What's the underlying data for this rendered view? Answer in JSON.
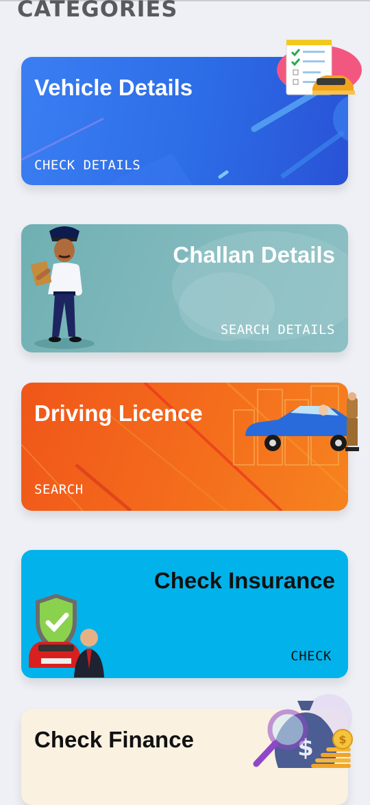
{
  "page": {
    "heading": "CATEGORIES"
  },
  "cards": [
    {
      "title": "Vehicle Details",
      "action": "CHECK DETAILS"
    },
    {
      "title": "Challan Details",
      "action": "SEARCH DETAILS"
    },
    {
      "title": "Driving Licence",
      "action": "SEARCH"
    },
    {
      "title": "Check Insurance",
      "action": "CHECK"
    },
    {
      "title": "Check Finance",
      "action": ""
    }
  ],
  "colors": {
    "vehicle_card": "#2c6ce6",
    "challan_card": "#7fb8bc",
    "licence_card": "#f46d1c",
    "insurance_card": "#02b3eb",
    "finance_card": "#fbf1e1"
  }
}
